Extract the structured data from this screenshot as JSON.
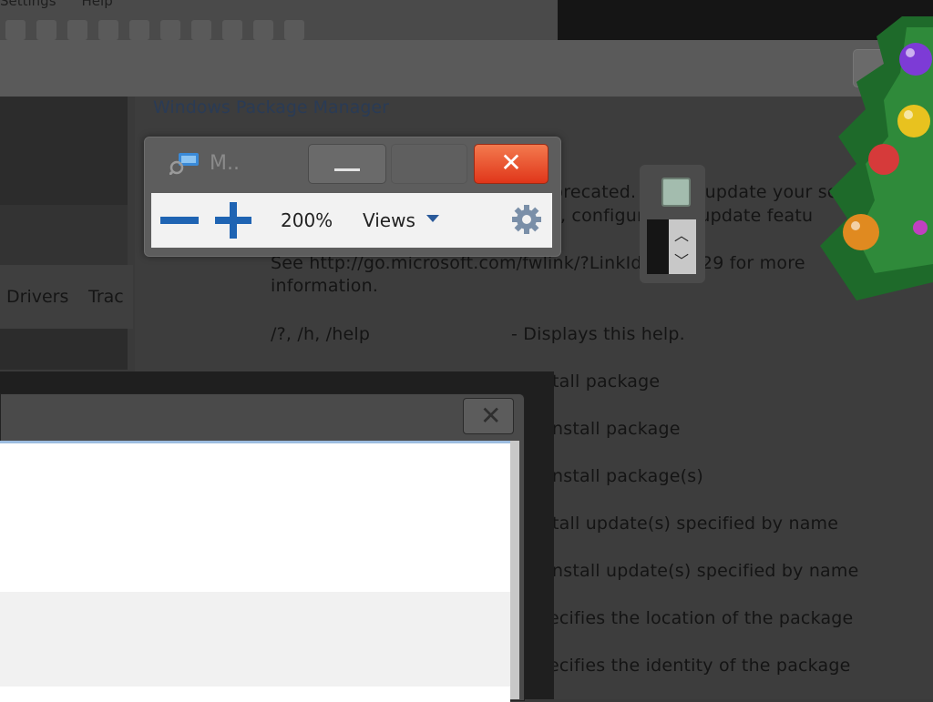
{
  "background_app": {
    "menu": [
      "Settings",
      "Help"
    ]
  },
  "command_window": {
    "title": "Windows Package Manager",
    "lines": [
      "precated. Please update your scri",
      "ll, configure and update featu",
      "See http://go.microsoft.com/fwlink/?LinkId=245329 for more",
      "information.",
      "/?, /h, /help",
      "- Displays this help.",
      "tall package",
      "nstall package",
      "nstall package(s)",
      "tall update(s) specified by name",
      "nstall update(s) specified by name",
      "ecifies the location of the package",
      "ecifies the identity of the package"
    ]
  },
  "left_tabs": [
    "Drivers",
    "Trac"
  ],
  "magnifier": {
    "title": "M..",
    "zoom_level": "200%",
    "views_label": "Views",
    "close_label": "✕"
  },
  "colors": {
    "accent_blue": "#1f64b3",
    "close_red": "#e5431f"
  }
}
